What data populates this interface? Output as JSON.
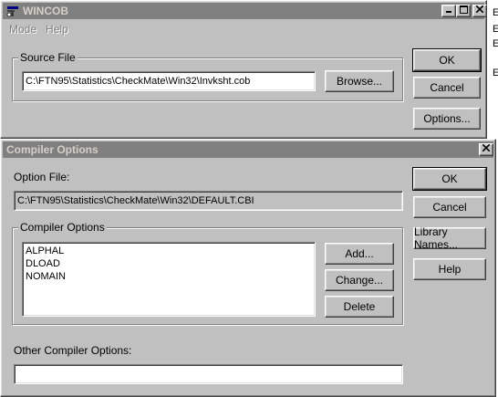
{
  "background": {
    "letters": [
      "E",
      "E",
      "E",
      "E"
    ]
  },
  "wincob": {
    "title": "WINCOB",
    "menu": [
      "Mode",
      "Help"
    ],
    "source_file": {
      "group_label": "Source File",
      "value": "C:\\FTN95\\Statistics\\CheckMate\\Win32\\Invksht.cob",
      "browse_label": "Browse..."
    },
    "buttons": {
      "ok": "OK",
      "cancel": "Cancel",
      "options": "Options..."
    }
  },
  "compiler_options": {
    "title": "Compiler Options",
    "option_file_label": "Option File:",
    "option_file_value": "C:\\FTN95\\Statistics\\CheckMate\\Win32\\DEFAULT.CBI",
    "group_label": "Compiler Options",
    "options_list": [
      "ALPHAL",
      "DLOAD",
      "NOMAIN"
    ],
    "list_buttons": {
      "add": "Add...",
      "change": "Change...",
      "delete": "Delete"
    },
    "other_label": "Other Compiler Options:",
    "other_value": "",
    "buttons": {
      "ok": "OK",
      "cancel": "Cancel",
      "library": "Library Names...",
      "help": "Help"
    }
  },
  "colors": {
    "titlebar_active": "#000080",
    "titlebar_inactive": "#808080",
    "face": "#c0c0c0"
  }
}
